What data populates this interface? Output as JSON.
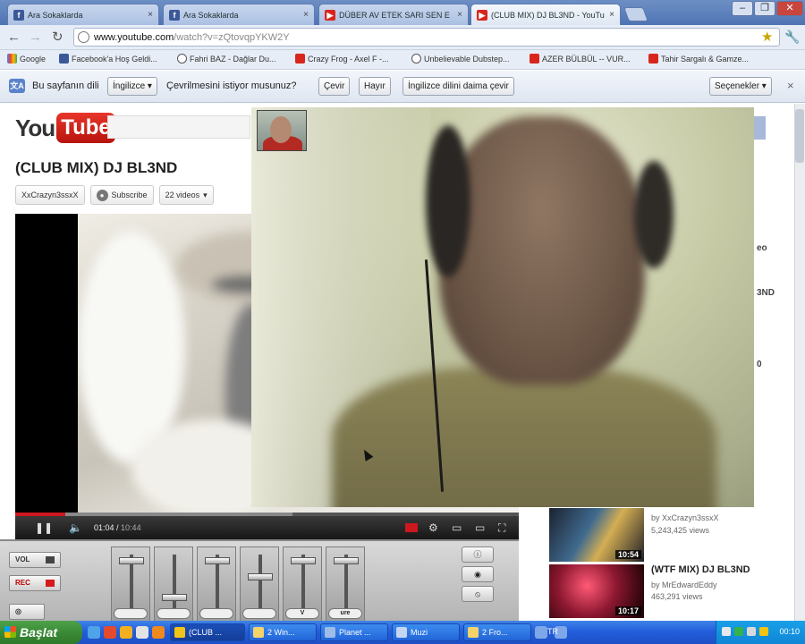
{
  "browser": {
    "tabs": [
      {
        "title": "Ara Sokaklarda",
        "icon": "facebook-icon"
      },
      {
        "title": "Ara Sokaklarda",
        "icon": "facebook-icon"
      },
      {
        "title": "DÜBER AV ETEK SARI SEN E",
        "icon": "youtube-icon"
      },
      {
        "title": "(CLUB MIX) DJ BL3ND - YouTu",
        "icon": "youtube-icon"
      }
    ],
    "url_host": "www.youtube.com",
    "url_path": "/watch?v=zQtovqpYKW2Y",
    "bookmarks": [
      {
        "label": "Google",
        "icon": "google-icon"
      },
      {
        "label": "Facebook'a Hoş Geldi...",
        "icon": "facebook-icon"
      },
      {
        "label": "Fahri BAZ - Dağlar Du...",
        "icon": "globe-icon"
      },
      {
        "label": "Crazy Frog - Axel F -...",
        "icon": "youtube-icon"
      },
      {
        "label": "Unbelievable Dubstep...",
        "icon": "globe-icon"
      },
      {
        "label": "AZER BÜLBÜL -- VUR...",
        "icon": "youtube-icon"
      },
      {
        "label": "Tahir Sargalı & Gamze...",
        "icon": "youtube-icon"
      }
    ]
  },
  "translate_bar": {
    "prompt": "Bu sayfanın dili",
    "language": "İngilizce",
    "question": "Çevrilmesini istiyor musunuz?",
    "translate": "Çevir",
    "no": "Hayır",
    "always": "İngilizce dilini daima çevir",
    "options": "Seçenekler"
  },
  "youtube": {
    "logo_you": "You",
    "logo_tube": "Tube",
    "video_title": "(CLUB MIX) DJ BL3ND",
    "channel": "XxCrazyn3ssxX",
    "subscribe": "Subscribe",
    "videos": "22 videos",
    "time_current": "01:04",
    "time_total": "10:44",
    "progress": 0.1,
    "buffered": 0.55,
    "edge_labels": [
      "eo",
      "3ND",
      "0"
    ],
    "related": [
      {
        "title": "",
        "by": "by XxCrazyn3ssxX",
        "views": "5,243,425 views",
        "duration": "10:54"
      },
      {
        "title": "(WTF MIX) DJ BL3ND",
        "by": "by MrEdwardEddy",
        "views": "463,291 views",
        "duration": "10:17"
      }
    ]
  },
  "mixer": {
    "vol": "VOL",
    "rec": "REC",
    "slot_labels": [
      "",
      "",
      "",
      "",
      "V",
      "ure"
    ],
    "fader_levels": [
      0.08,
      0.8,
      0.08,
      0.4,
      0.08,
      0.08
    ]
  },
  "taskbar": {
    "start": "Başlat",
    "tasks": [
      {
        "label": "(CLUB ...",
        "icon": "chrome-icon"
      },
      {
        "label": "2 Win...",
        "icon": "folder-icon"
      },
      {
        "label": "Planet ...",
        "icon": "app-icon"
      },
      {
        "label": "Muzi",
        "icon": "app-icon"
      },
      {
        "label": "2 Fro...",
        "icon": "folder-icon"
      }
    ],
    "tray_lang": "TR",
    "clock": "00:10"
  }
}
